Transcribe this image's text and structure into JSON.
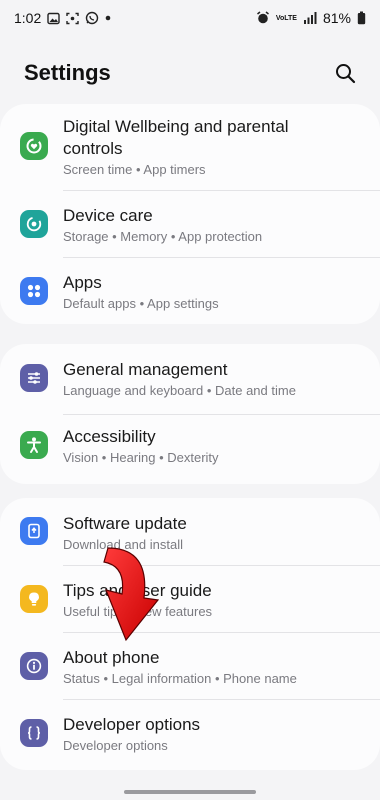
{
  "status_bar": {
    "time": "1:02",
    "battery": "81%",
    "network": "VoLTE",
    "icons": [
      "gallery-icon",
      "screenshot-icon",
      "whatsapp-icon",
      "dot-icon",
      "alarm-icon",
      "volte-icon",
      "signal-icon",
      "battery-icon"
    ]
  },
  "header": {
    "title": "Settings",
    "search_icon": "search-icon"
  },
  "groups": [
    {
      "items": [
        {
          "title_line1": "Digital Wellbeing and parental",
          "title_line2": "controls",
          "subtitle": "Screen time  •  App timers",
          "icon": "wellbeing-icon",
          "color": "#3aaa4f"
        },
        {
          "title": "Device care",
          "subtitle": "Storage  •  Memory  •  App protection",
          "icon": "device-care-icon",
          "color": "#1fa49a"
        },
        {
          "title": "Apps",
          "subtitle": "Default apps  •  App settings",
          "icon": "apps-icon",
          "color": "#3d7af0"
        }
      ]
    },
    {
      "items": [
        {
          "title": "General management",
          "subtitle": "Language and keyboard  •  Date and time",
          "icon": "general-management-icon",
          "color": "#5e5fa7"
        },
        {
          "title": "Accessibility",
          "subtitle": "Vision  •  Hearing  •  Dexterity",
          "icon": "accessibility-icon",
          "color": "#3aaa4f"
        }
      ]
    },
    {
      "items": [
        {
          "title": "Software update",
          "subtitle": "Download and install",
          "icon": "software-update-icon",
          "color": "#3d7af0"
        },
        {
          "title": "Tips and user guide",
          "subtitle": "Useful tips  •  New features",
          "icon": "tips-icon",
          "color": "#f4b81f"
        },
        {
          "title": "About phone",
          "subtitle": "Status  •  Legal information  •  Phone name",
          "icon": "info-icon",
          "color": "#5e5fa7"
        },
        {
          "title": "Developer options",
          "subtitle": "Developer options",
          "icon": "developer-icon",
          "color": "#5e5fa7"
        }
      ]
    }
  ],
  "annotation": {
    "icon": "red-arrow-icon",
    "color": "#e00000"
  }
}
